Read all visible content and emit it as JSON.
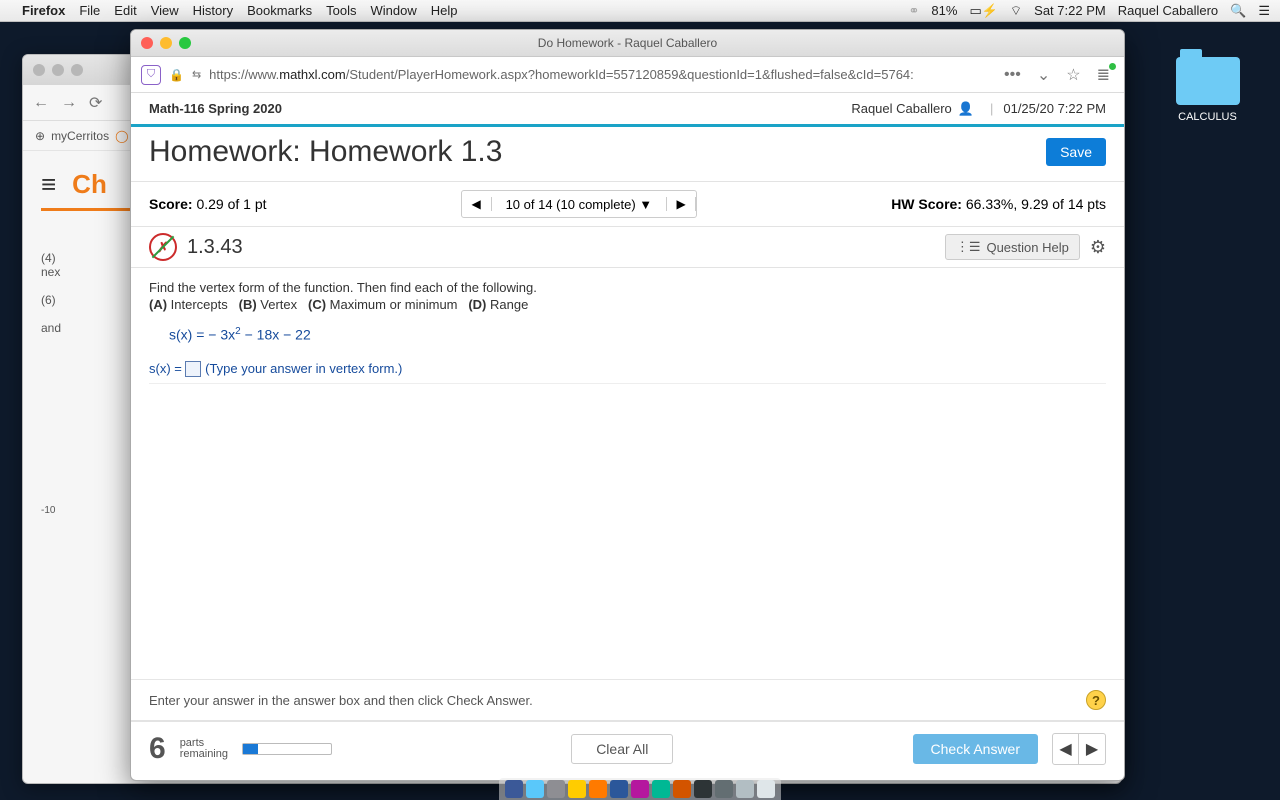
{
  "menubar": {
    "app": "Firefox",
    "items": [
      "File",
      "Edit",
      "View",
      "History",
      "Bookmarks",
      "Tools",
      "Window",
      "Help"
    ],
    "battery": "81%",
    "clock": "Sat 7:22 PM",
    "user": "Raquel Caballero"
  },
  "desktop": {
    "folder_label": "CALCULUS"
  },
  "bg_window": {
    "bookmark": "myCerritos",
    "brand": "Ch",
    "side_items": [
      "(4)",
      "nex",
      "(6)",
      "and",
      "-10"
    ]
  },
  "fg_window": {
    "title": "Do Homework - Raquel Caballero",
    "url_prefix": "https://www.",
    "url_domain": "mathxl.com",
    "url_path": "/Student/PlayerHomework.aspx?homeworkId=557120859&questionId=1&flushed=false&cId=5764:",
    "course": "Math-116 Spring 2020",
    "student": "Raquel Caballero",
    "datetime": "01/25/20 7:22 PM",
    "hw_title": "Homework: Homework 1.3",
    "save": "Save",
    "score_label": "Score:",
    "score_val": "0.29 of 1 pt",
    "nav_mid": "10 of 14 (10 complete)",
    "hwscore_label": "HW Score:",
    "hwscore_val": "66.33%, 9.29 of 14 pts",
    "qnum": "1.3.43",
    "qhelp": "Question Help",
    "instr": "Find the vertex form of the function. Then find each of the following.",
    "partA": "(A)",
    "partA_t": "Intercepts",
    "partB": "(B)",
    "partB_t": "Vertex",
    "partC": "(C)",
    "partC_t": "Maximum or minimum",
    "partD": "(D)",
    "partD_t": "Range",
    "eqn_pre": "s(x) = − 3x",
    "eqn_sup": "2",
    "eqn_post": " − 18x − 22",
    "ans_pre": "s(x) = ",
    "ans_hint": "(Type your answer in vertex form.)",
    "enter_hint": "Enter your answer in the answer box and then click Check Answer.",
    "parts_num": "6",
    "parts_l1": "parts",
    "parts_l2": "remaining",
    "clear": "Clear All",
    "check": "Check Answer"
  }
}
